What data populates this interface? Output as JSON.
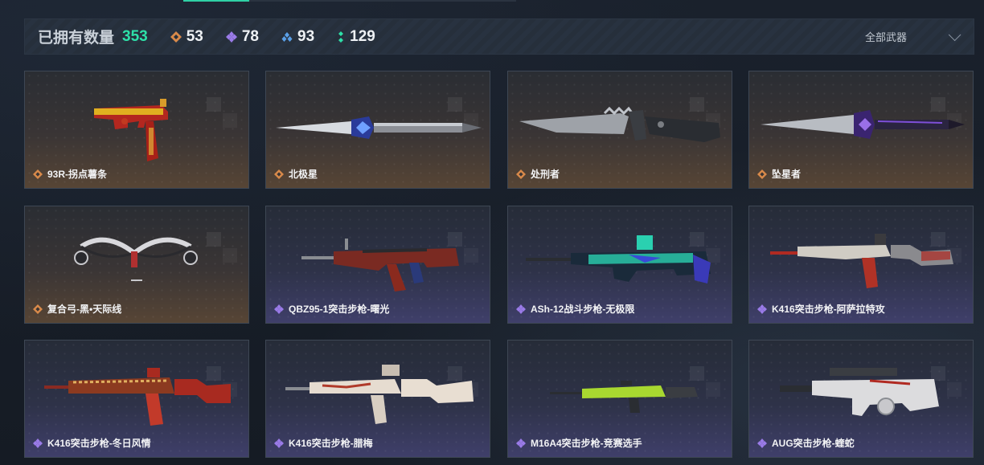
{
  "header": {
    "owned_label": "已拥有数量",
    "owned_count": "353",
    "stats": [
      {
        "icon": "orange-rarity-icon",
        "color": "#d98a4a",
        "value": "53"
      },
      {
        "icon": "purple-rarity-icon",
        "color": "#9a7be8",
        "value": "78"
      },
      {
        "icon": "blue-rarity-icon",
        "color": "#5aa0e8",
        "value": "93"
      },
      {
        "icon": "green-rarity-icon",
        "color": "#2ee0a8",
        "value": "129"
      }
    ],
    "filter_label": "全部武器"
  },
  "colors": {
    "accent": "#2ee0a8",
    "orange": "#d98a4a",
    "purple": "#9a7be8"
  },
  "items": [
    {
      "name": "93R-拐点薯条",
      "rarity": "orange",
      "weapon": "pistol"
    },
    {
      "name": "北极星",
      "rarity": "orange",
      "weapon": "dagger-blue"
    },
    {
      "name": "处刑者",
      "rarity": "orange",
      "weapon": "knife-serrated"
    },
    {
      "name": "坠星者",
      "rarity": "orange",
      "weapon": "dagger-purple"
    },
    {
      "name": "复合弓-黑•天际线",
      "rarity": "orange",
      "weapon": "bow"
    },
    {
      "name": "QBZ95-1突击步枪-曙光",
      "rarity": "purple",
      "weapon": "rifle-red"
    },
    {
      "name": "ASh-12战斗步枪-无极限",
      "rarity": "purple",
      "weapon": "rifle-neon"
    },
    {
      "name": "K416突击步枪-阿萨拉特攻",
      "rarity": "purple",
      "weapon": "rifle-white-red"
    },
    {
      "name": "K416突击步枪-冬日风情",
      "rarity": "purple",
      "weapon": "rifle-xmas"
    },
    {
      "name": "K416突击步枪-腊梅",
      "rarity": "purple",
      "weapon": "rifle-plum"
    },
    {
      "name": "M16A4突击步枪-竞赛选手",
      "rarity": "purple",
      "weapon": "rifle-lime"
    },
    {
      "name": "AUG突击步枪-蝰蛇",
      "rarity": "purple",
      "weapon": "rifle-aug"
    }
  ]
}
